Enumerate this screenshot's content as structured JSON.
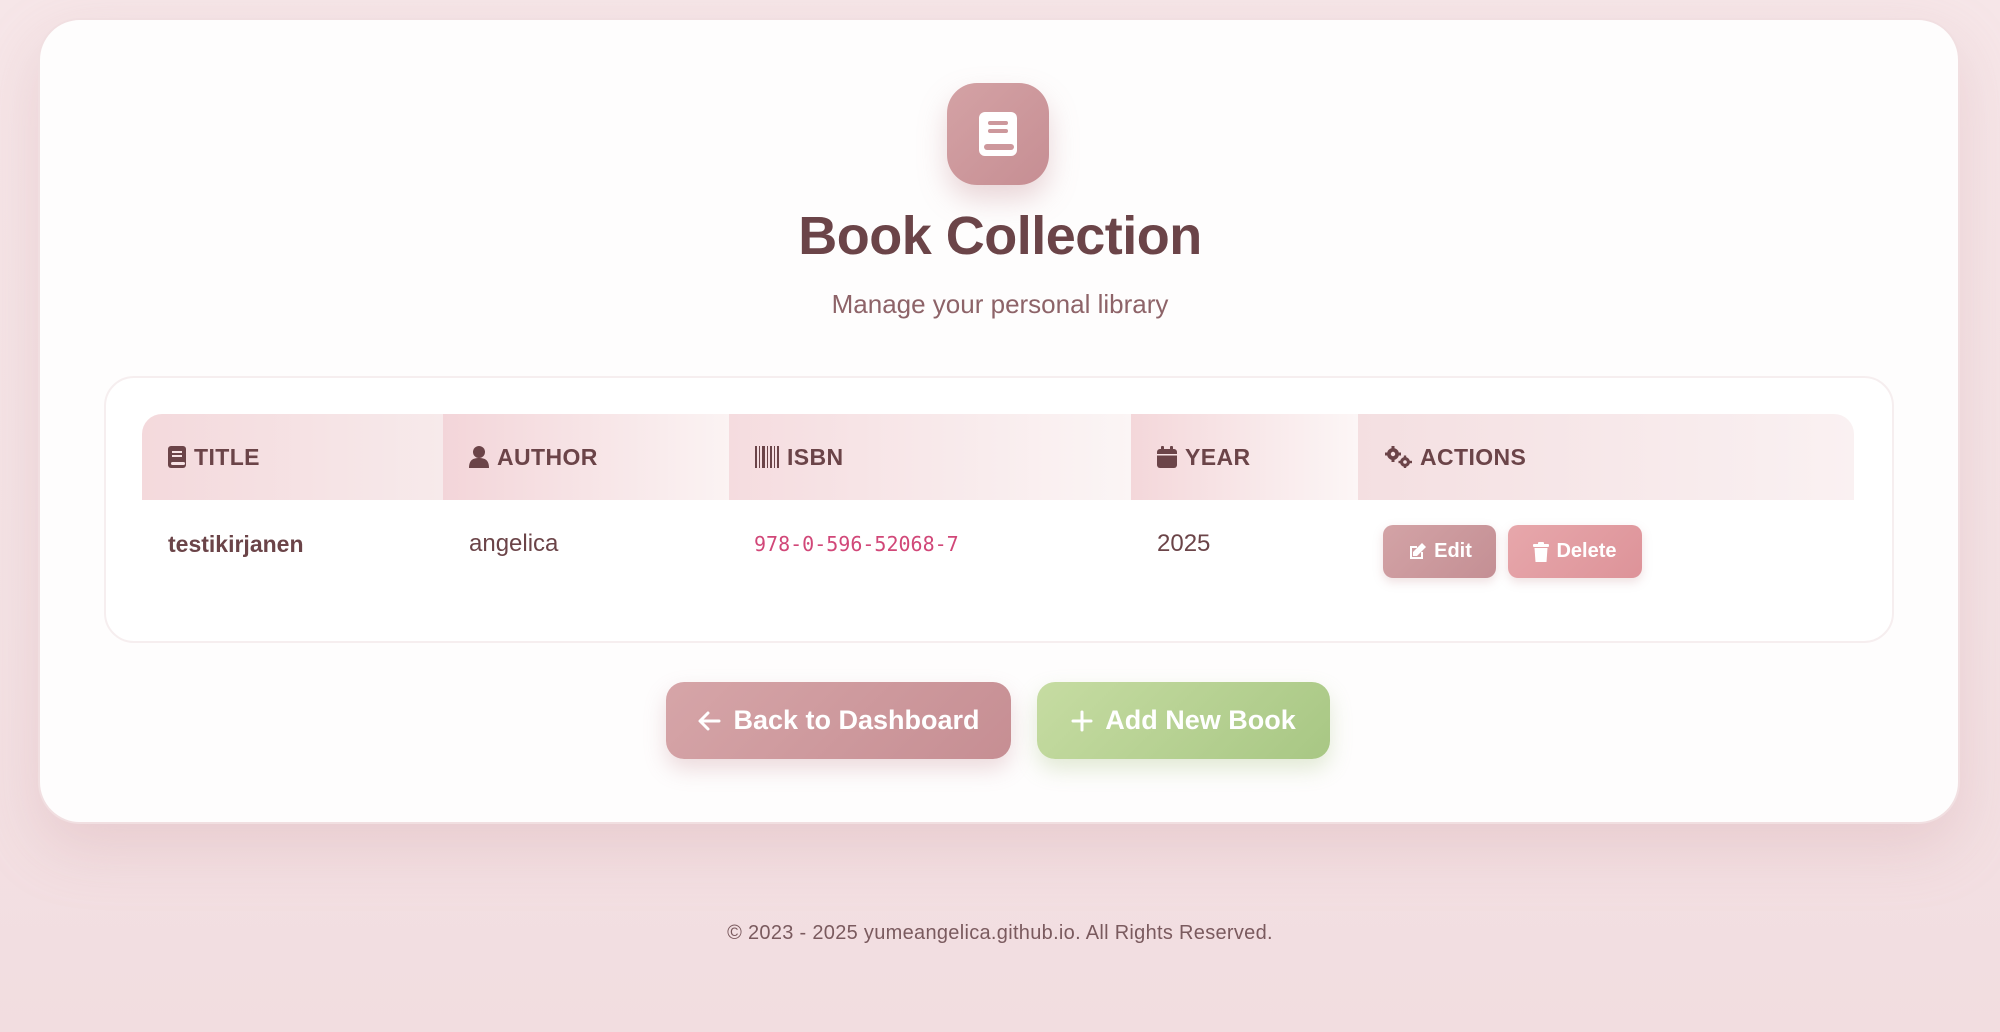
{
  "header": {
    "logo_icon": "book-icon",
    "title": "Book Collection",
    "subtitle": "Manage your personal library"
  },
  "table": {
    "columns": [
      {
        "label": "TITLE",
        "icon": "book-icon"
      },
      {
        "label": "AUTHOR",
        "icon": "user-icon"
      },
      {
        "label": "ISBN",
        "icon": "barcode-icon"
      },
      {
        "label": "YEAR",
        "icon": "calendar-icon"
      },
      {
        "label": "ACTIONS",
        "icon": "gears-icon"
      }
    ],
    "rows": [
      {
        "title": "testikirjanen",
        "author": "angelica",
        "isbn": "978-0-596-52068-7",
        "year": "2025",
        "edit_label": "Edit",
        "delete_label": "Delete"
      }
    ]
  },
  "actions": {
    "back_label": "Back to Dashboard",
    "add_label": "Add New Book"
  },
  "footer": {
    "text": "© 2023 - 2025 yumeangelica.github.io. All Rights Reserved."
  },
  "colors": {
    "primary": "#c99397",
    "danger": "#e19ba0",
    "success": "#b5d193",
    "text": "#6b4448",
    "isbn": "#d14778"
  }
}
